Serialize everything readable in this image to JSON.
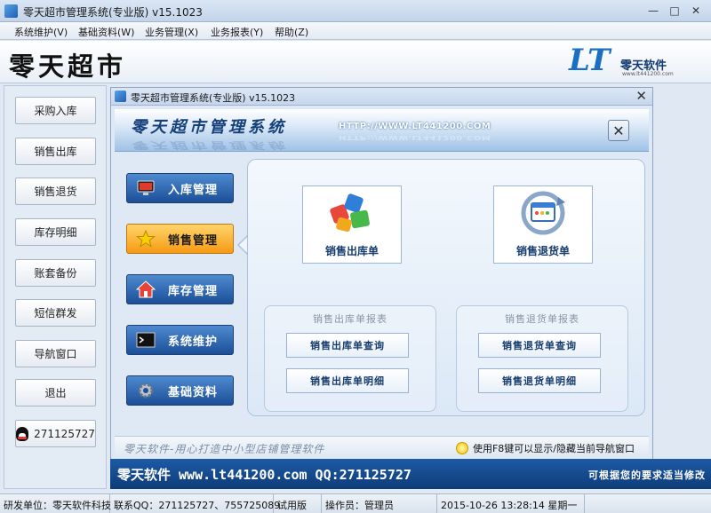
{
  "window": {
    "title": "零天超市管理系统(专业版)  v15.1023",
    "minimize": "—",
    "maximize": "□",
    "close": "✕"
  },
  "menu": [
    "系统维护(V)",
    "基础资料(W)",
    "业务管理(X)",
    "业务报表(Y)",
    "帮助(Z)"
  ],
  "banner": {
    "brand": "零天超市",
    "logo_mark": "LT",
    "logo_name": "零天软件",
    "logo_url": "www.lt441200.com"
  },
  "sidebar": [
    "采购入库",
    "销售出库",
    "销售退货",
    "库存明细",
    "账套备份",
    "短信群发",
    "导航窗口",
    "退出"
  ],
  "qq_button": "271125727",
  "inner": {
    "title": "零天超市管理系统(专业版)  v15.1023",
    "close": "✕",
    "header_title": "零天超市管理系统",
    "header_url": "HTTP://WWW.LT441200.COM",
    "header_close": "✕"
  },
  "nav": [
    {
      "label": "入库管理",
      "icon": "monitor-icon"
    },
    {
      "label": "销售管理",
      "icon": "star-icon"
    },
    {
      "label": "库存管理",
      "icon": "home-icon"
    },
    {
      "label": "系统维护",
      "icon": "terminal-icon"
    },
    {
      "label": "基础资料",
      "icon": "gear-icon"
    }
  ],
  "actions": {
    "out_order": "销售出库单",
    "return_order": "销售退货单"
  },
  "groups": {
    "out": {
      "title": "销售出库单报表",
      "query": "销售出库单查询",
      "detail": "销售出库单明细"
    },
    "ret": {
      "title": "销售退货单报表",
      "query": "销售退货单查询",
      "detail": "销售退货单明细"
    }
  },
  "slogan": {
    "left": "零天软件-用心打造中小型店铺管理软件",
    "right": "使用F8键可以显示/隐藏当前导航窗口"
  },
  "band": {
    "text": "零天软件  www.lt441200.com  QQ:271125727",
    "tail": "可根据您的要求适当修改"
  },
  "status": [
    "研发单位：零天软件科技",
    "联系QQ：271125727、755725089",
    "试用版",
    "操作员：管理员",
    "2015-10-26  13:28:14 星期一",
    ""
  ]
}
